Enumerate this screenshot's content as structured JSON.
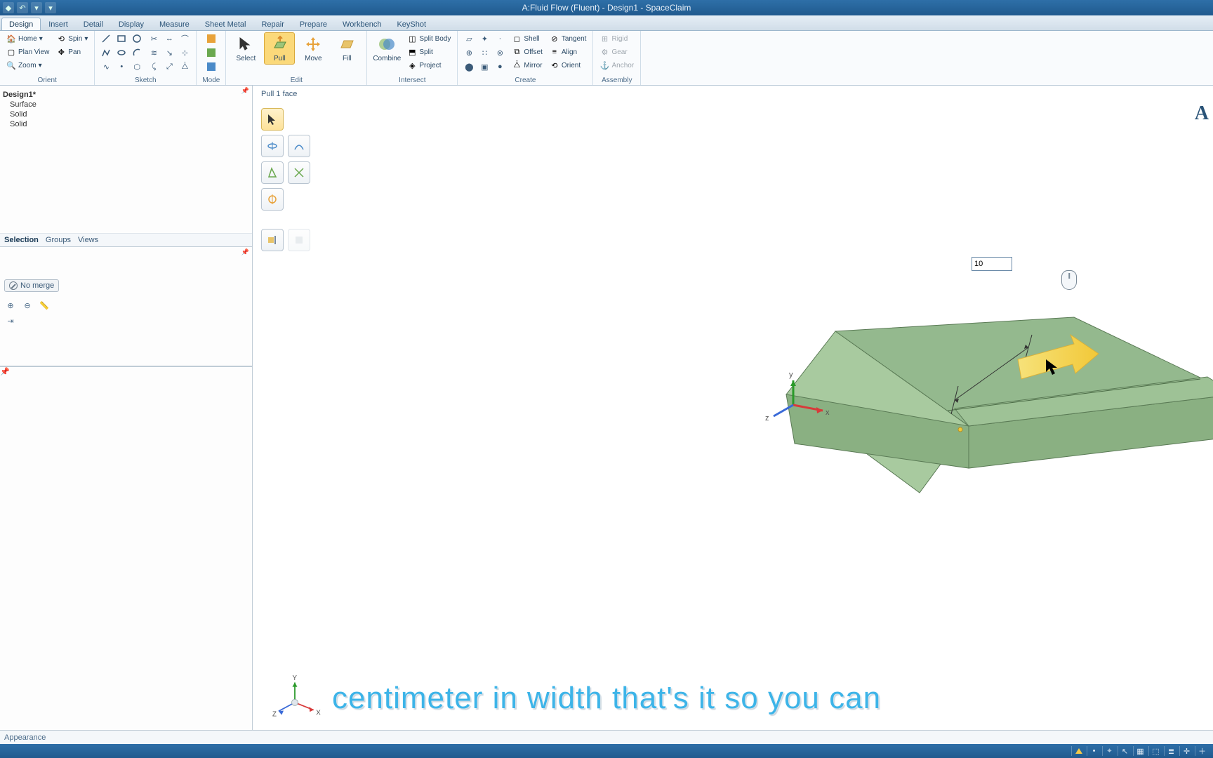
{
  "window": {
    "title": "A:Fluid Flow (Fluent) - Design1 - SpaceClaim"
  },
  "tabs": {
    "items": [
      "Design",
      "Insert",
      "Detail",
      "Display",
      "Measure",
      "Sheet Metal",
      "Repair",
      "Prepare",
      "Workbench",
      "KeyShot"
    ],
    "active": 0
  },
  "ribbon": {
    "orient": {
      "label": "Orient",
      "home": "Home",
      "spin": "Spin",
      "planview": "Plan View",
      "pan": "Pan",
      "zoom": "Zoom"
    },
    "sketch": {
      "label": "Sketch"
    },
    "mode": {
      "label": "Mode"
    },
    "edit": {
      "label": "Edit",
      "select": "Select",
      "pull": "Pull",
      "move": "Move",
      "fill": "Fill"
    },
    "intersect": {
      "label": "Intersect",
      "combine": "Combine",
      "splitbody": "Split Body",
      "split": "Split",
      "project": "Project"
    },
    "create": {
      "label": "Create"
    },
    "body": {
      "shell": "Shell",
      "offset": "Offset",
      "mirror": "Mirror"
    },
    "relate": {
      "tangent": "Tangent",
      "align": "Align",
      "orient": "Orient"
    },
    "assembly": {
      "label": "Assembly",
      "rigid": "Rigid",
      "gear": "Gear",
      "anchor": "Anchor"
    }
  },
  "tree": {
    "root": "Design1*",
    "nodes": [
      "Surface",
      "Solid",
      "Solid"
    ]
  },
  "leftTabs": {
    "items": [
      "Selection",
      "Groups",
      "Views"
    ],
    "active": 0
  },
  "options": {
    "nomerge": "No merge"
  },
  "dimension_value": "10",
  "hint": "Pull 1 face",
  "cornerLetter": "A",
  "propLabel": "Appearance",
  "subtitle": "centimeter in width that's it so you can",
  "axes": {
    "x": "X",
    "y": "Y",
    "z": "Z"
  },
  "triad_small": {
    "x": "x",
    "y": "y",
    "z": "z"
  }
}
